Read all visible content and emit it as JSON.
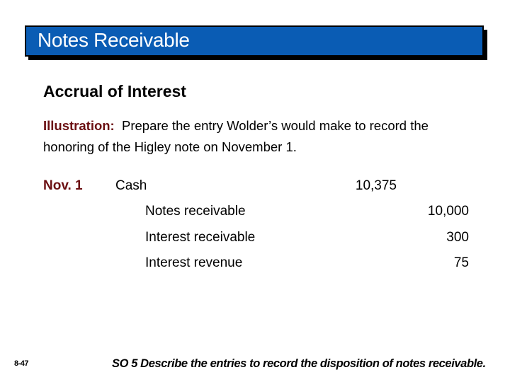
{
  "slide": {
    "title": "Notes Receivable",
    "subtitle": "Accrual of Interest",
    "illustration_label": "Illustration:",
    "illustration_text": "Prepare the entry Wolder’s would make to record the honoring of the Higley note on November 1.",
    "journal_entry": {
      "date": "Nov. 1",
      "lines": [
        {
          "account": "Cash",
          "side": "debit",
          "amount": "10,375"
        },
        {
          "account": "Notes receivable",
          "side": "credit",
          "amount": "10,000"
        },
        {
          "account": "Interest receivable",
          "side": "credit",
          "amount": "300"
        },
        {
          "account": "Interest revenue",
          "side": "credit",
          "amount": "75"
        }
      ]
    },
    "slide_number": "8-47",
    "study_objective": "SO 5  Describe the entries to record the disposition of notes receivable."
  },
  "colors": {
    "title_bar": "#0a5cb4",
    "accent_label": "#6b0f12"
  }
}
